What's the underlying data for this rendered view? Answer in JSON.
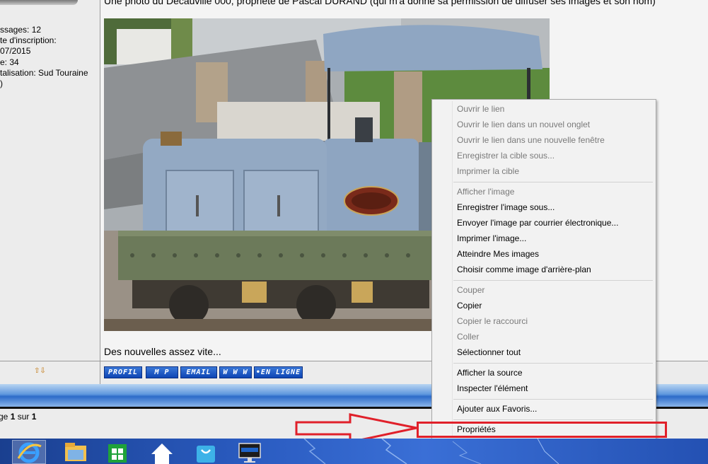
{
  "post": {
    "user_info": [
      "ssages: 12",
      "te d'inscription:",
      "07/2015",
      "e: 34",
      "talisation: Sud Touraine",
      ")"
    ],
    "caption": "Une photo du Decauville 000, propriété de Pascal DURAND (qui m'a donné sa permission de diffuser ses images et son nom)",
    "footer_text": "Des nouvelles assez vite...",
    "nav_arrows": "⇧⇩"
  },
  "profile_buttons": {
    "profil": "PROFIL",
    "mp": "M P",
    "email": "EMAIL",
    "www": "W W W",
    "online": "•EN LIGNE"
  },
  "pager": {
    "prefix": "ge ",
    "current": "1",
    "mid": " sur ",
    "total": "1"
  },
  "context_menu": {
    "open_link": "Ouvrir le lien",
    "open_new_tab": "Ouvrir le lien dans un nouvel onglet",
    "open_new_window": "Ouvrir le lien dans une nouvelle fenêtre",
    "save_target": "Enregistrer la cible sous...",
    "print_target": "Imprimer la cible",
    "show_image": "Afficher l'image",
    "save_image": "Enregistrer l'image sous...",
    "email_image": "Envoyer l'image par courrier électronique...",
    "print_image": "Imprimer l'image...",
    "goto_my_pictures": "Atteindre Mes images",
    "set_background": "Choisir comme image d'arrière-plan",
    "cut": "Couper",
    "copy": "Copier",
    "copy_shortcut": "Copier le raccourci",
    "paste": "Coller",
    "select_all": "Sélectionner tout",
    "view_source": "Afficher la source",
    "inspect": "Inspecter l'élément",
    "add_favorites": "Ajouter aux Favoris...",
    "properties": "Propriétés"
  },
  "taskbar": {
    "icons": [
      "internet-explorer-icon",
      "file-explorer-icon",
      "store-icon",
      "home-icon",
      "shopping-bag-icon",
      "lenovo-monitor-icon"
    ]
  },
  "colors": {
    "highlight": "#e0202a",
    "button_blue": "#1450c0"
  }
}
